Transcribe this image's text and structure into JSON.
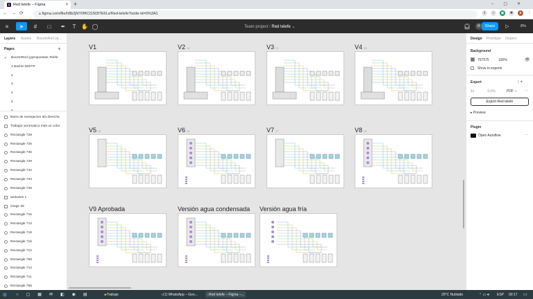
{
  "browser": {
    "tabs": [
      {
        "title": "Red telefe – Figma"
      }
    ],
    "new_tab": "+",
    "url": "figma.com/file/h8b2jNY0fKCGSDf7E6Ls/Red-telefe?node-id=0%3A1"
  },
  "toolbar": {
    "breadcrumb_team": "Team project",
    "breadcrumb_sep": "/",
    "file_name": "Red telefe",
    "avatar": "R",
    "share_label": "Share",
    "zoom": "8%"
  },
  "left_panel": {
    "tabs": [
      "Layers",
      "Assets",
      "BocetoRed yp..."
    ],
    "pages_title": "Pages",
    "pages": [
      "BocetoRed yypropuestas Telefe",
      "1 Bachiri MSITP",
      "2",
      "3",
      "4",
      "5",
      "6"
    ],
    "layers": [
      "Barra de navegacion ala derecha",
      "Trabajar acromatico más un color",
      "Rectangle 729",
      "Rectangle 725",
      "Rectangle 735",
      "Rectangle 728",
      "Rectangle 734",
      "Rectangle 723",
      "Rectangle 728",
      "anduvies 1",
      "image 36",
      "Rectangle 716",
      "Rectangle 713",
      "Rectangle 718",
      "Rectangle 715",
      "Rectangle 712",
      "Rectangle 769",
      "Rectangle 714",
      "Rectangle 711",
      "Rectangle 766"
    ]
  },
  "canvas": {
    "frames": [
      {
        "label": "V1",
        "num": ""
      },
      {
        "label": "V2",
        "num": "18"
      },
      {
        "label": "V3",
        "num": "21"
      },
      {
        "label": "V4",
        "num": "20"
      },
      {
        "label": "V5",
        "num": "25"
      },
      {
        "label": "V6",
        "num": "24"
      },
      {
        "label": "V7",
        "num": "27"
      },
      {
        "label": "V8",
        "num": "26"
      },
      {
        "label": "V9 Aprobada",
        "num": ""
      },
      {
        "label": "Versión agua condensada",
        "num": ""
      },
      {
        "label": "Versión agua fría",
        "num": ""
      }
    ]
  },
  "right_panel": {
    "tabs": [
      "Design",
      "Prototype",
      "Inspect"
    ],
    "background_title": "Background",
    "bg_hex": "757575",
    "bg_opacity": "100%",
    "bg_color": "#757575",
    "show_exports": "Show in exports",
    "export_title": "Export",
    "export_scale": "1x",
    "export_suffix": "Suffix",
    "export_format": "PDF",
    "export_button": "Export Red telefe",
    "preview": "Preview",
    "plugin_title": "Plugin",
    "plugin_name": "Open Autoflow"
  },
  "taskbar": {
    "apps": [
      "Trabajo",
      "(1) WhatsApp – Goo...",
      "Red telefe – Figma –..."
    ],
    "weather": "20°C",
    "weather_desc": "Nublado",
    "lang": "ESP",
    "time": "00:17"
  }
}
